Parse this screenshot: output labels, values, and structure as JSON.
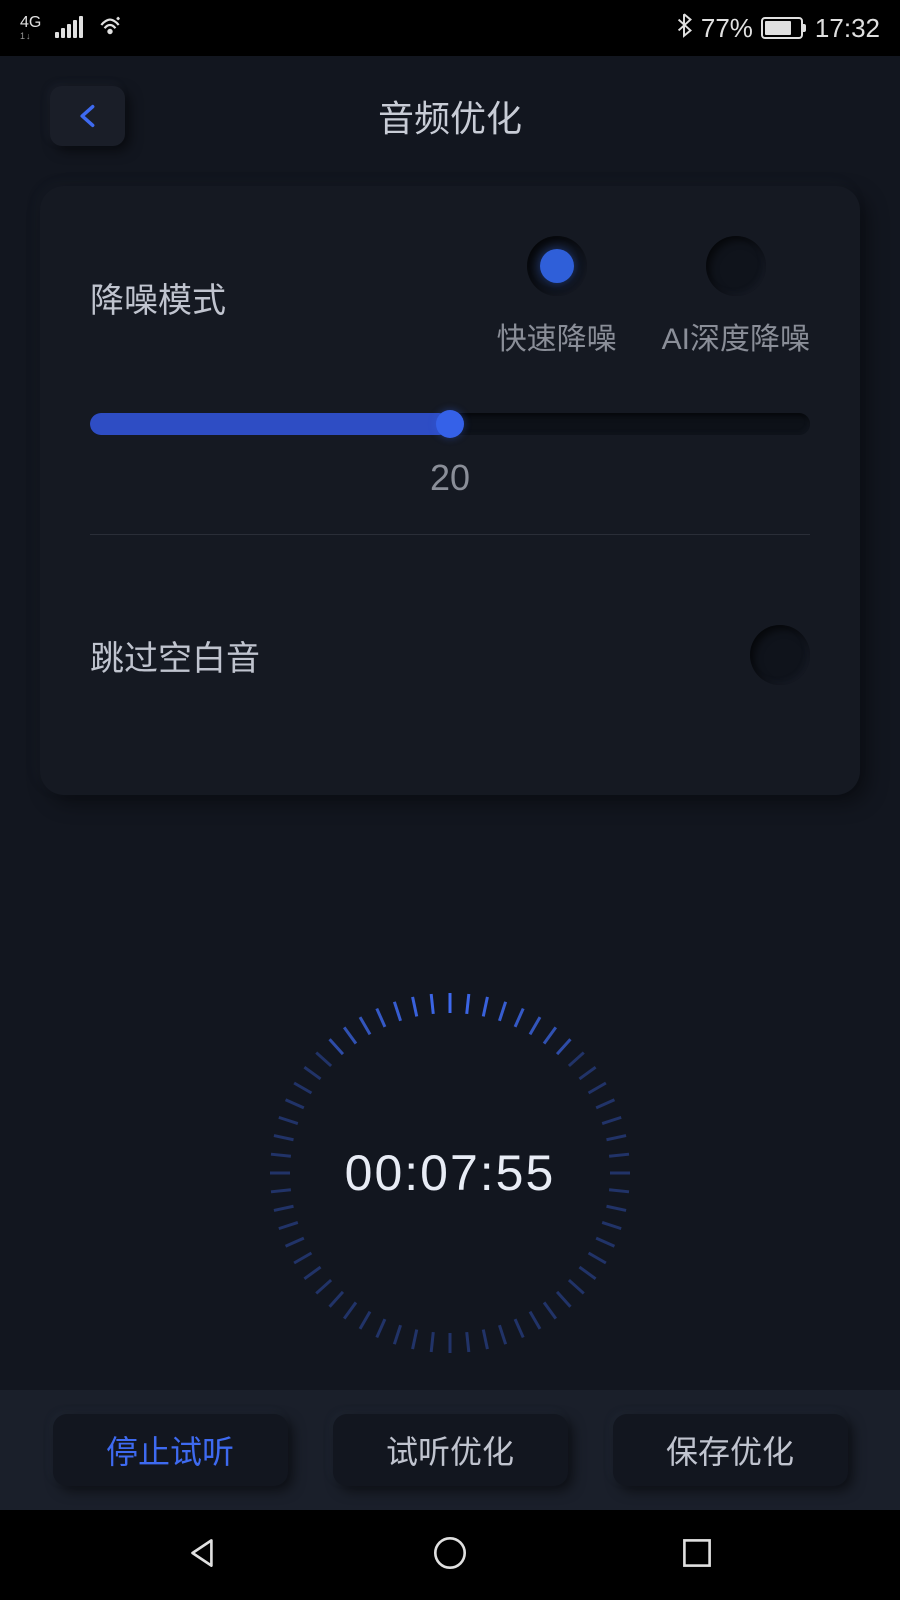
{
  "status": {
    "network_type": "4G",
    "battery_pct": "77%",
    "time": "17:32"
  },
  "header": {
    "title": "音频优化"
  },
  "noise": {
    "label": "降噪模式",
    "option_fast": "快速降噪",
    "option_ai": "AI深度降噪",
    "slider_value": "20",
    "slider_pct": 50
  },
  "skip": {
    "label": "跳过空白音"
  },
  "timer": {
    "text": "00:07:55"
  },
  "buttons": {
    "stop_preview": "停止试听",
    "preview_opt": "试听优化",
    "save_opt": "保存优化"
  },
  "colors": {
    "accent": "#2f5fd9",
    "text_primary": "#c8ccd6",
    "text_secondary": "#8a8e98"
  }
}
